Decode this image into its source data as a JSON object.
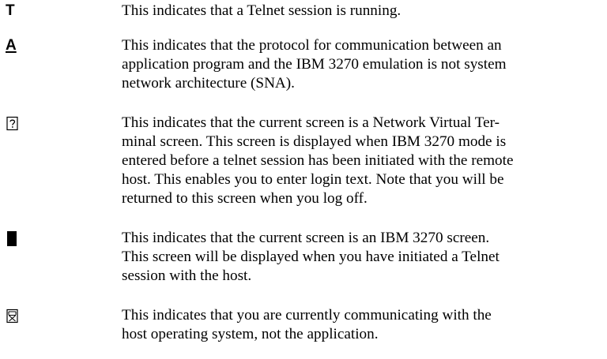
{
  "entries": [
    {
      "symbol": "T",
      "lines": [
        "This indicates that a Telnet session is running."
      ]
    },
    {
      "symbol": "A",
      "lines": [
        "This indicates that the protocol for communication between an",
        "application program and the IBM 3270 emulation is not system",
        "network architecture (SNA)."
      ]
    },
    {
      "symbol_icon": "question-box-icon",
      "lines": [
        "This indicates that the current screen is a Network Virtual Ter-",
        "minal screen. This screen is displayed when IBM 3270 mode is",
        "entered before a telnet session has been initiated with the remote",
        "host. This enables you to enter login text. Note that you will be",
        "returned to this screen when you log off."
      ]
    },
    {
      "symbol_icon": "solid-block-icon",
      "lines": [
        "This indicates that the current screen is an IBM 3270 screen.",
        "This screen will be displayed when you have initiated a Telnet",
        "session with the host."
      ]
    },
    {
      "symbol_icon": "host-system-box-icon",
      "lines": [
        "This indicates that you are currently communicating with the",
        "host operating system, not the application."
      ]
    }
  ]
}
